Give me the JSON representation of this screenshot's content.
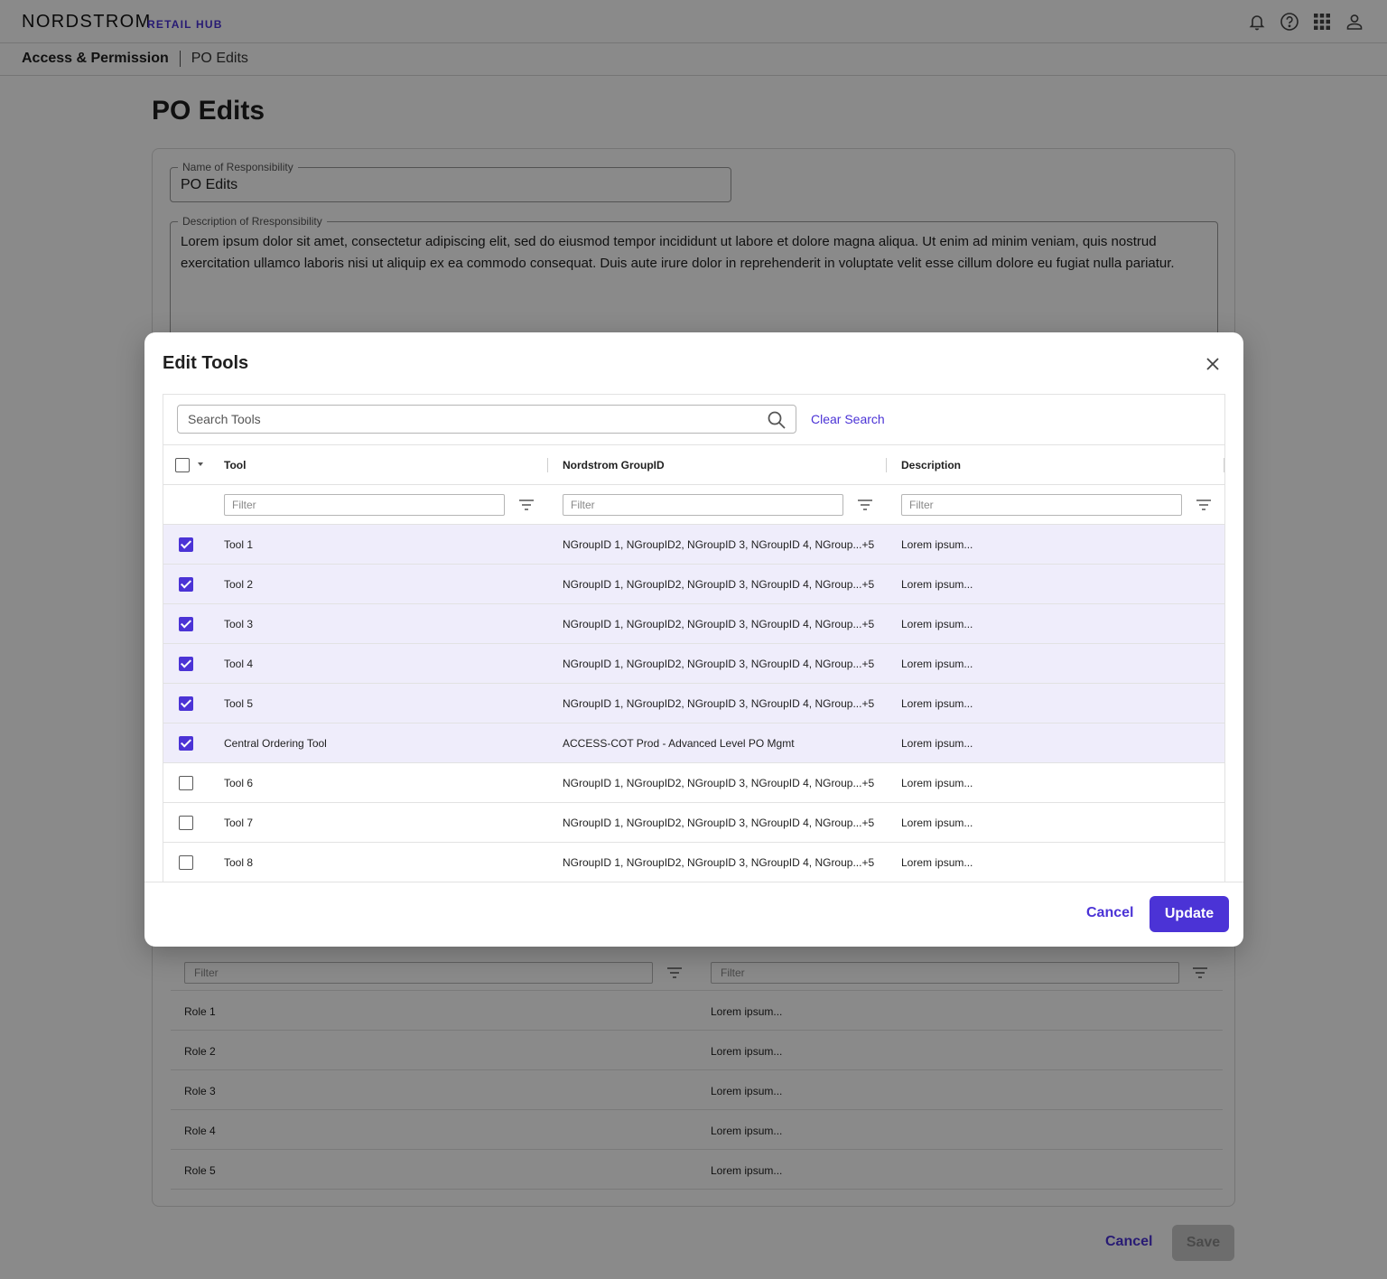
{
  "header": {
    "brand": "NORDSTROM",
    "brand_sub": "RETAIL HUB",
    "icons": [
      "bell-icon",
      "help-icon",
      "apps-grid-icon",
      "user-icon"
    ]
  },
  "breadcrumb": {
    "root": "Access & Permission",
    "current": "PO Edits"
  },
  "page": {
    "title": "PO Edits",
    "name_label": "Name of Responsibility",
    "name_value": "PO Edits",
    "desc_label": "Description of Rresponsibility",
    "desc_value": "Lorem ipsum dolor sit amet, consectetur adipiscing elit, sed do eiusmod tempor incididunt ut labore et dolore magna aliqua. Ut enim ad minim veniam, quis nostrud exercitation ullamco laboris nisi ut aliquip ex ea commodo consequat. Duis aute irure dolor in reprehenderit in voluptate velit esse cillum dolore eu fugiat nulla pariatur.",
    "roles_filter_placeholder": "Filter",
    "roles": [
      {
        "name": "Role 1",
        "desc": "Lorem ipsum..."
      },
      {
        "name": "Role 2",
        "desc": "Lorem ipsum..."
      },
      {
        "name": "Role 3",
        "desc": "Lorem ipsum..."
      },
      {
        "name": "Role 4",
        "desc": "Lorem ipsum..."
      },
      {
        "name": "Role 5",
        "desc": "Lorem ipsum..."
      }
    ],
    "cancel_label": "Cancel",
    "save_label": "Save"
  },
  "modal": {
    "title": "Edit Tools",
    "search_placeholder": "Search Tools",
    "clear_search": "Clear Search",
    "columns": [
      "Tool",
      "Nordstrom GroupID",
      "Description"
    ],
    "filter_placeholder": "Filter",
    "rows": [
      {
        "checked": true,
        "tool": "Tool 1",
        "group": "NGroupID 1, NGroupID2, NGroupID 3, NGroupID 4, NGroup...+5",
        "desc": "Lorem ipsum..."
      },
      {
        "checked": true,
        "tool": "Tool 2",
        "group": "NGroupID 1, NGroupID2, NGroupID 3, NGroupID 4, NGroup...+5",
        "desc": "Lorem ipsum..."
      },
      {
        "checked": true,
        "tool": "Tool 3",
        "group": "NGroupID 1, NGroupID2, NGroupID 3, NGroupID 4, NGroup...+5",
        "desc": "Lorem ipsum..."
      },
      {
        "checked": true,
        "tool": "Tool 4",
        "group": "NGroupID 1, NGroupID2, NGroupID 3, NGroupID 4, NGroup...+5",
        "desc": "Lorem ipsum..."
      },
      {
        "checked": true,
        "tool": "Tool 5",
        "group": "NGroupID 1, NGroupID2, NGroupID 3, NGroupID 4, NGroup...+5",
        "desc": "Lorem ipsum..."
      },
      {
        "checked": true,
        "tool": "Central Ordering Tool",
        "group": "ACCESS-COT Prod - Advanced Level PO Mgmt",
        "desc": "Lorem ipsum..."
      },
      {
        "checked": false,
        "tool": "Tool 6",
        "group": "NGroupID 1, NGroupID2, NGroupID 3, NGroupID 4, NGroup...+5",
        "desc": "Lorem ipsum..."
      },
      {
        "checked": false,
        "tool": "Tool 7",
        "group": "NGroupID 1, NGroupID2, NGroupID 3, NGroupID 4, NGroup...+5",
        "desc": "Lorem ipsum..."
      },
      {
        "checked": false,
        "tool": "Tool 8",
        "group": "NGroupID 1, NGroupID2, NGroupID 3, NGroupID 4, NGroup...+5",
        "desc": "Lorem ipsum..."
      }
    ],
    "cancel_label": "Cancel",
    "update_label": "Update"
  },
  "colors": {
    "accent": "#4b33d6",
    "selected_row": "#efedfb",
    "overlay": "#000000"
  }
}
